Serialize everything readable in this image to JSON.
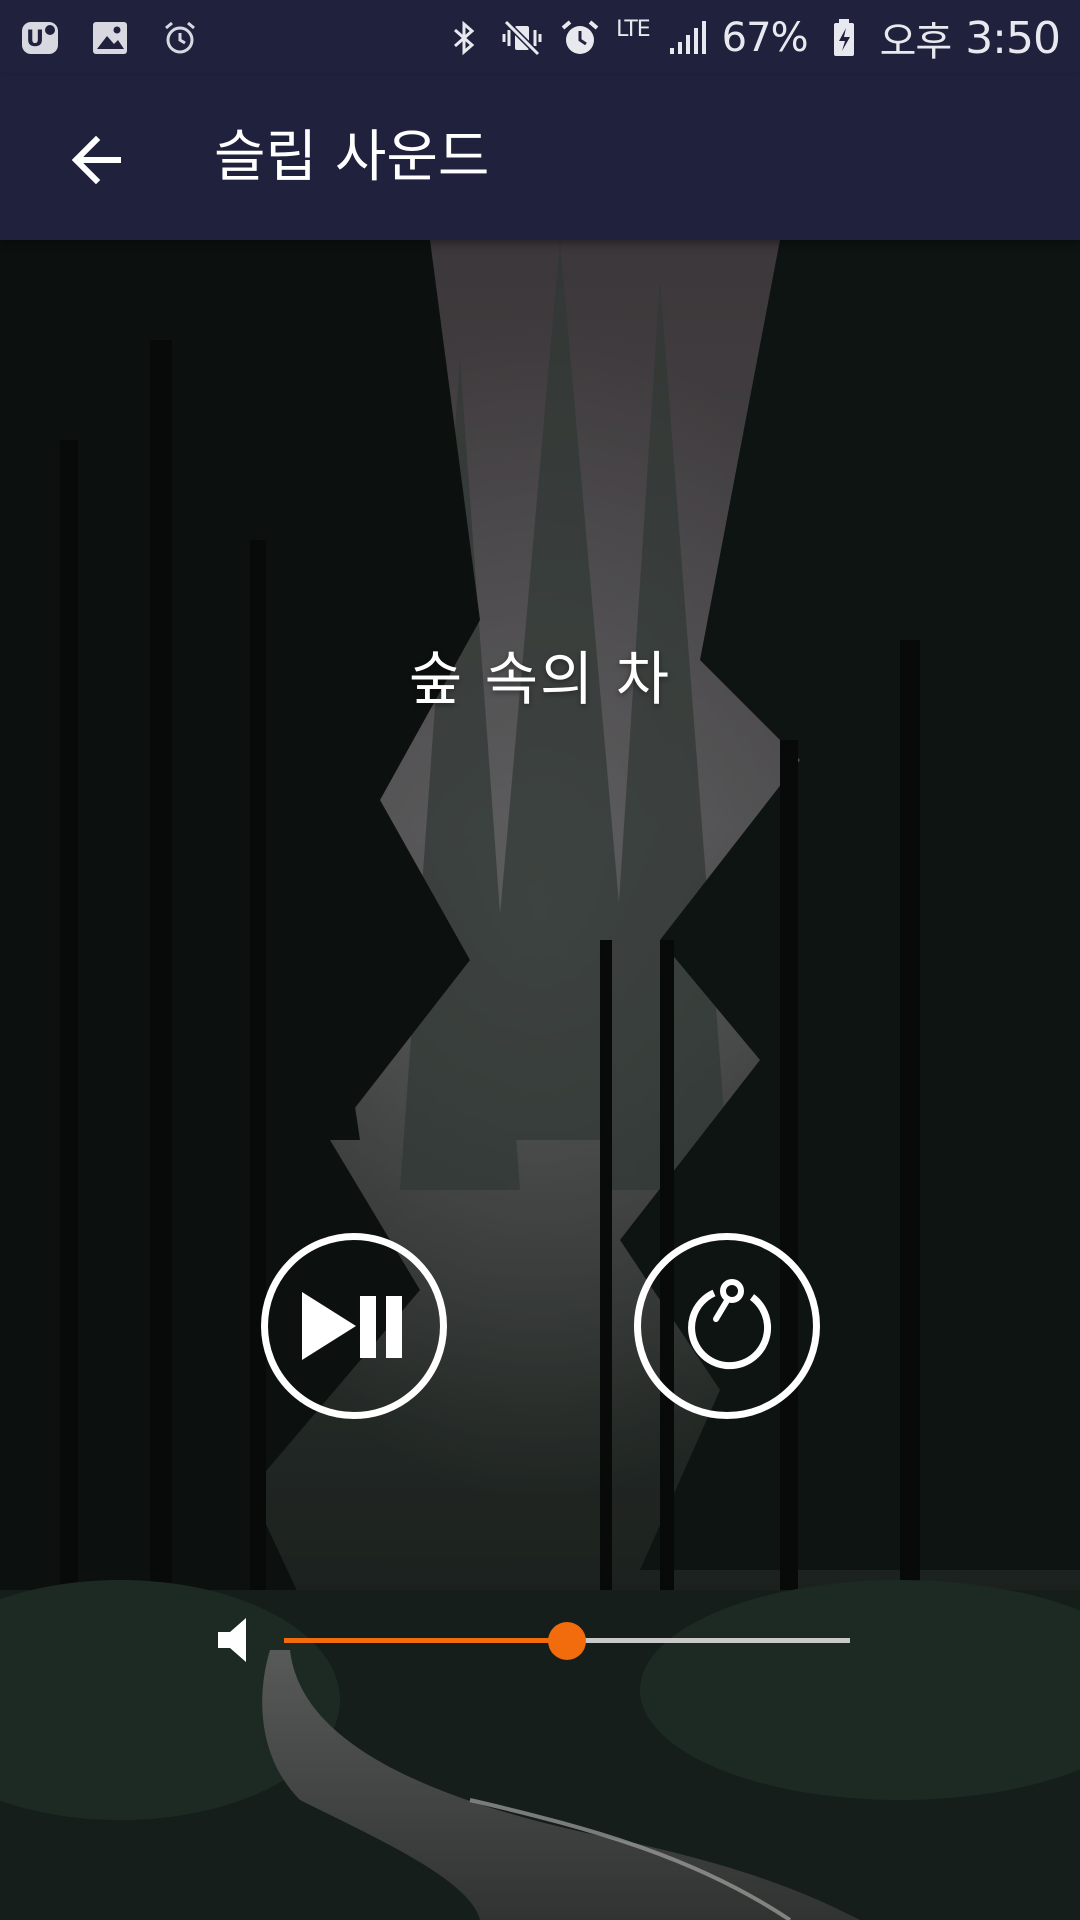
{
  "status_bar": {
    "battery": "67%",
    "ampm": "오후",
    "time": "3:50",
    "network": "LTE",
    "icons": [
      "u-plus-icon",
      "gallery-icon",
      "alarm-clock-icon",
      "bluetooth-icon",
      "vibrate-mute-icon",
      "alarm-icon",
      "lte-icon",
      "signal-icon",
      "battery-charging-icon"
    ]
  },
  "app_bar": {
    "title": "슬립 사운드",
    "back_icon": "arrow-back-icon"
  },
  "player": {
    "sound_title": "숲 속의 차",
    "play_pause_icon": "play-pause-icon",
    "timer_icon": "timer-icon"
  },
  "volume": {
    "icon": "speaker-icon",
    "level": 0.5,
    "accent_color": "#f26b0c"
  },
  "colors": {
    "app_bar": "#20223d",
    "accent": "#f26b0c"
  }
}
